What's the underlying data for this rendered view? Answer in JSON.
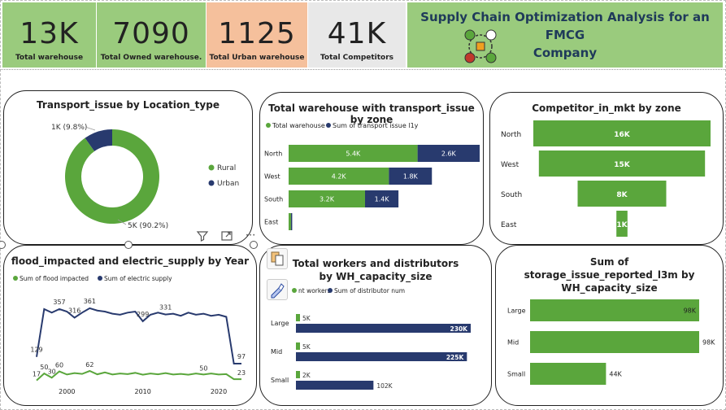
{
  "kpis": [
    {
      "value": "13K",
      "label": "Total warehouse",
      "bg": "#9acb7d"
    },
    {
      "value": "7090",
      "label": "Total Owned warehouse.",
      "bg": "#9acb7d"
    },
    {
      "value": "1125",
      "label": "Total Urban warehouse",
      "bg": "#f5c09c"
    },
    {
      "value": "41K",
      "label": "Total Competitors",
      "bg": "#e8e8e8"
    }
  ],
  "header": {
    "title_line1": "Supply Chain Optimization Analysis for an FMCG",
    "title_line2": "Company",
    "logo_icon": "supply-chain-network-icon"
  },
  "colors": {
    "green": "#5aa63c",
    "navy": "#283a6e",
    "flood_line": "#5aa63c",
    "electric_line": "#283a6e"
  },
  "chart_data": [
    {
      "id": "transport-issue-donut",
      "type": "pie",
      "title": "Transport_issue by Location_type",
      "categories": [
        "Rural",
        "Urban"
      ],
      "values": [
        90.2,
        9.8
      ],
      "data_labels": [
        "5K (90.2%)",
        "1K (9.8%)"
      ],
      "legend": "right"
    },
    {
      "id": "warehouse-transport-zone",
      "type": "bar",
      "title": "Total warehouse with transport_issue by zone",
      "categories": [
        "North",
        "West",
        "South",
        "East"
      ],
      "series": [
        {
          "name": "Total warehouse",
          "values": [
            5.4,
            4.2,
            3.2,
            0.1
          ],
          "labels": [
            "5.4K",
            "4.2K",
            "3.2K",
            ""
          ]
        },
        {
          "name": "Sum of transport issue l1y",
          "values": [
            2.6,
            1.8,
            1.4,
            0.05
          ],
          "labels": [
            "2.6K",
            "1.8K",
            "1.4K",
            ""
          ]
        }
      ],
      "stacked": true,
      "orientation": "horizontal",
      "legend": "top-left"
    },
    {
      "id": "competitor-zone",
      "type": "bar",
      "title": "Competitor_in_mkt by zone",
      "categories": [
        "North",
        "West",
        "South",
        "East"
      ],
      "values": [
        16,
        15,
        8,
        1
      ],
      "labels": [
        "16K",
        "15K",
        "8K",
        "1K"
      ],
      "style": "funnel"
    },
    {
      "id": "flood-electric-year",
      "type": "line",
      "title": "flood_impacted and electric_supply by Year",
      "x": [
        1996,
        1997,
        1998,
        1999,
        2000,
        2001,
        2002,
        2003,
        2004,
        2005,
        2006,
        2007,
        2008,
        2009,
        2010,
        2011,
        2012,
        2013,
        2014,
        2015,
        2016,
        2017,
        2018,
        2019,
        2020,
        2021,
        2022,
        2023
      ],
      "xticks": [
        "2000",
        "2010",
        "2020"
      ],
      "series": [
        {
          "name": "Sum of flood impacted",
          "values": [
            17,
            50,
            30,
            60,
            45,
            52,
            48,
            62,
            46,
            55,
            45,
            50,
            47,
            53,
            44,
            50,
            46,
            52,
            45,
            48,
            44,
            50,
            45,
            50,
            45,
            47,
            23,
            23
          ]
        },
        {
          "name": "Sum of electric supply",
          "values": [
            129,
            357,
            340,
            357,
            345,
            316,
            340,
            361,
            350,
            345,
            335,
            330,
            340,
            345,
            299,
            330,
            340,
            331,
            335,
            325,
            340,
            330,
            335,
            325,
            330,
            320,
            97,
            97
          ]
        }
      ],
      "point_labels": [
        {
          "series": 1,
          "index": 0,
          "text": "129"
        },
        {
          "series": 1,
          "index": 3,
          "text": "357"
        },
        {
          "series": 1,
          "index": 5,
          "text": "316"
        },
        {
          "series": 1,
          "index": 7,
          "text": "361"
        },
        {
          "series": 1,
          "index": 14,
          "text": "299"
        },
        {
          "series": 1,
          "index": 17,
          "text": "331"
        },
        {
          "series": 1,
          "index": 27,
          "text": "97"
        },
        {
          "series": 0,
          "index": 0,
          "text": "17"
        },
        {
          "series": 0,
          "index": 1,
          "text": "50"
        },
        {
          "series": 0,
          "index": 2,
          "text": "30"
        },
        {
          "series": 0,
          "index": 3,
          "text": "60"
        },
        {
          "series": 0,
          "index": 7,
          "text": "62"
        },
        {
          "series": 0,
          "index": 22,
          "text": "50"
        },
        {
          "series": 0,
          "index": 27,
          "text": "23"
        }
      ],
      "legend": "top-left"
    },
    {
      "id": "workers-distributors-size",
      "type": "bar",
      "title": "Total workers and distributors by WH_capacity_size",
      "categories": [
        "Large",
        "Mid",
        "Small"
      ],
      "series": [
        {
          "name": "nt workers",
          "values": [
            5,
            5,
            2
          ],
          "labels": [
            "5K",
            "5K",
            "2K"
          ]
        },
        {
          "name": "Sum of distributor num",
          "values": [
            230,
            225,
            102
          ],
          "labels": [
            "230K",
            "225K",
            "102K"
          ]
        }
      ],
      "orientation": "horizontal",
      "legend": "top-left"
    },
    {
      "id": "storage-issue-size",
      "type": "bar",
      "title": "Sum of storage_issue_reported_l3m by WH_capacity_size",
      "categories": [
        "Large",
        "Mid",
        "Small"
      ],
      "values": [
        98,
        98,
        44
      ],
      "labels": [
        "98K",
        "98K",
        "44K"
      ],
      "orientation": "horizontal"
    }
  ],
  "toolbar": {
    "filter_icon": "filter-icon",
    "focus_icon": "focus-mode-icon",
    "more_icon": "more-options-icon",
    "more_label": "···"
  },
  "side_icons": {
    "copy": "copy-visual-icon",
    "format": "format-brush-icon"
  }
}
